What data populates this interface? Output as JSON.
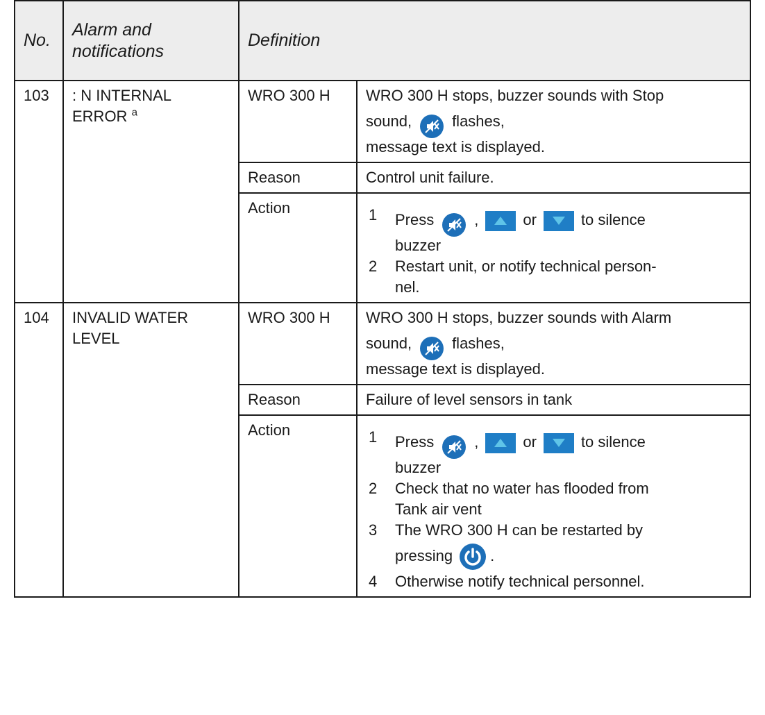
{
  "header": {
    "no": "No.",
    "alarm": "Alarm and notifications",
    "definition": "Definition"
  },
  "rows": [
    {
      "no": "103",
      "alarm": ": N INTERNAL ERROR",
      "alarm_sup": "a",
      "effect_label": "WRO 300 H",
      "effect_line1": "WRO 300 H stops, buzzer sounds with Stop",
      "effect_line2_pre": "sound,",
      "effect_line2_post": "flashes,",
      "effect_line3": "message text is displayed.",
      "reason_label": "Reason",
      "reason": "Control unit failure.",
      "action_label": "Action",
      "steps": [
        {
          "n": "1",
          "pre": "Press",
          "sep": ",",
          "or": "or",
          "post": "to silence",
          "cont": "buzzer"
        },
        {
          "n": "2",
          "text": "Restart unit, or notify technical person-",
          "cont": "nel."
        }
      ]
    },
    {
      "no": "104",
      "alarm": "INVALID WATER LEVEL",
      "effect_label": "WRO 300 H",
      "effect_line1": "WRO 300 H stops, buzzer sounds with Alarm",
      "effect_line2_pre": "sound,",
      "effect_line2_post": "flashes,",
      "effect_line3": "message text is displayed.",
      "reason_label": "Reason",
      "reason": "Failure of level sensors in tank",
      "action_label": "Action",
      "steps": [
        {
          "n": "1",
          "pre": "Press",
          "sep": ",",
          "or": "or",
          "post": "to silence",
          "cont": "buzzer"
        },
        {
          "n": "2",
          "text": "Check that no water has flooded from",
          "cont": "Tank air vent"
        },
        {
          "n": "3",
          "text": "The WRO 300 H can be restarted by",
          "cont": "pressing",
          "cont_post": "."
        },
        {
          "n": "4",
          "text": "Otherwise notify technical personnel."
        }
      ]
    }
  ],
  "icons": {
    "mute": "mute-buzzer-icon",
    "up": "up-arrow-button-icon",
    "down": "down-arrow-button-icon",
    "power": "power-button-icon"
  },
  "colors": {
    "icon_blue": "#1d6fb8",
    "button_blue": "#1f7ec6",
    "header_bg": "#ededed"
  }
}
